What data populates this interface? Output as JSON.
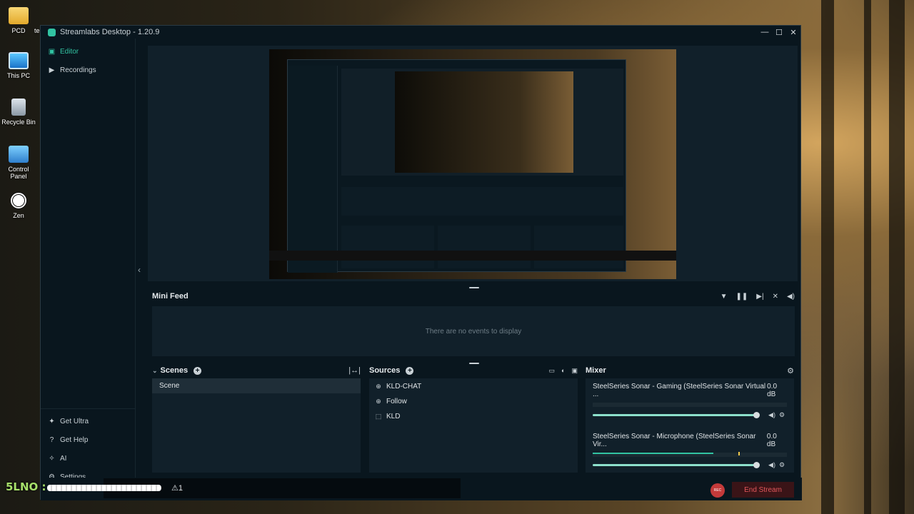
{
  "desktop": {
    "icons": [
      {
        "label": "PCD"
      },
      {
        "label": "This PC"
      },
      {
        "label": "Recycle Bin"
      },
      {
        "label": "Control Panel"
      },
      {
        "label": "Zen"
      }
    ],
    "partial_label": "te"
  },
  "window": {
    "title": "Streamlabs Desktop - 1.20.9",
    "controls": {
      "minimize": "—",
      "maximize": "☐",
      "close": "✕"
    }
  },
  "sidebar": {
    "nav": [
      {
        "label": "Editor",
        "icon": "editor-icon",
        "active": true
      },
      {
        "label": "Recordings",
        "icon": "recordings-icon",
        "active": false
      }
    ],
    "bottom": [
      {
        "label": "Get Ultra",
        "icon": "ultra-icon"
      },
      {
        "label": "Get Help",
        "icon": "help-icon"
      },
      {
        "label": "AI",
        "icon": "ai-icon"
      },
      {
        "label": "Settings",
        "icon": "gear-icon"
      }
    ]
  },
  "mini_feed": {
    "title": "Mini Feed",
    "empty_text": "There are no events to display"
  },
  "scenes": {
    "title": "Scenes",
    "items": [
      "Scene"
    ]
  },
  "sources": {
    "title": "Sources",
    "items": [
      {
        "label": "KLD-CHAT",
        "icon": "globe-icon"
      },
      {
        "label": "Follow",
        "icon": "globe-icon"
      },
      {
        "label": "KLD",
        "icon": "dashed-square-icon"
      }
    ]
  },
  "mixer": {
    "title": "Mixer",
    "channels": [
      {
        "name": "SteelSeries Sonar - Gaming (SteelSeries Sonar Virtual ...",
        "db": "0.0 dB",
        "level": 0,
        "volume": 1.0
      },
      {
        "name": "SteelSeries Sonar - Microphone (SteelSeries Sonar Vir...",
        "db": "0.0 dB",
        "level": 0.62,
        "volume": 1.0
      }
    ]
  },
  "footer": {
    "rec_label": "REC",
    "end_stream": "End Stream"
  },
  "overlay": {
    "name": "5LNO :",
    "alert": "⚠1"
  },
  "colors": {
    "accent": "#31c3a2",
    "danger": "#e2575b",
    "bg": "#09161e",
    "panel": "#11202a"
  }
}
